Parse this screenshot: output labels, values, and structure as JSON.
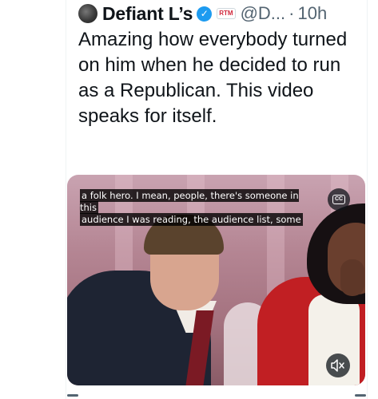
{
  "header": {
    "display_name": "Defiant L’s",
    "affiliation_badge": "RTM",
    "handle": "@D...",
    "separator": "·",
    "timestamp": "10h"
  },
  "tweet": {
    "text": "Amazing how everybody turned on him when he decided to run as a Republican. This video speaks for itself."
  },
  "video": {
    "caption_line1": "a folk hero. I mean, people, there's someone in this",
    "caption_line2": "audience I was reading, the audience list, some",
    "cc_label": "CC",
    "mute_icon": "muted-speaker-icon"
  },
  "colors": {
    "verified": "#1d9bf0",
    "text": "#0f1419",
    "secondary": "#536471"
  }
}
